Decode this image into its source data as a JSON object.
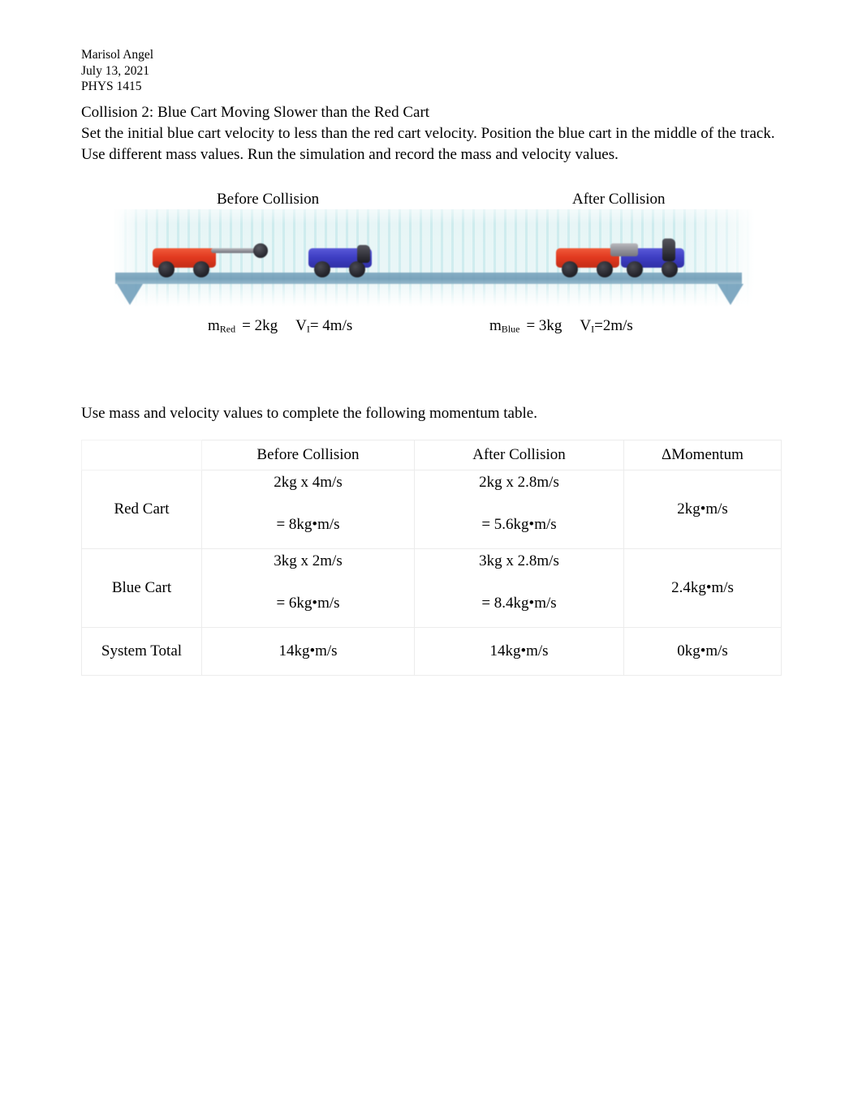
{
  "document": {
    "author": "Marisol Angel",
    "date": "July 13, 2021",
    "course": "PHYS 1415"
  },
  "section": {
    "title": "Collision 2: Blue Cart Moving Slower than the Red Cart",
    "instructions": "Set the initial blue cart velocity to less than the red cart velocity. Position the blue cart in the middle of the track. Use different mass values. Run the simulation and record the mass and velocity values."
  },
  "figure": {
    "before_label": "Before Collision",
    "after_label": "After Collision",
    "red_mass_symbol": "m",
    "red_mass_subscript": "Red",
    "red_mass_value": "= 2kg",
    "red_velocity_symbol": "V",
    "red_velocity_subscript": "I",
    "red_velocity_value": "= 4m/s",
    "blue_mass_symbol": "m",
    "blue_mass_subscript": "Blue",
    "blue_mass_value": "= 3kg",
    "blue_velocity_symbol": "V",
    "blue_velocity_subscript": "I",
    "blue_velocity_value": "=2m/s",
    "colors": {
      "red_cart": "#e23a20",
      "blue_cart": "#3f3fc4",
      "track": "#6f9cb6",
      "background": "#e6f5f6"
    }
  },
  "table_prompt": "Use mass and velocity values to complete the following momentum table.",
  "chart_data": {
    "type": "table",
    "title": "Momentum table",
    "columns": [
      "",
      "Before Collision",
      "After Collision",
      "ΔMomentum"
    ],
    "rows": [
      {
        "label": "Red Cart",
        "before_expr": "2kg x 4m/s",
        "before_result": "= 8kg•m/s",
        "after_expr": "2kg x 2.8m/s",
        "after_result": "= 5.6kg•m/s",
        "delta": "2kg•m/s"
      },
      {
        "label": "Blue Cart",
        "before_expr": "3kg x 2m/s",
        "before_result": "= 6kg•m/s",
        "after_expr": "3kg x 2.8m/s",
        "after_result": "= 8.4kg•m/s",
        "delta": "2.4kg•m/s"
      },
      {
        "label": "System Total",
        "before_expr": "14kg•m/s",
        "before_result": "",
        "after_expr": "14kg•m/s",
        "after_result": "",
        "delta": "0kg•m/s"
      }
    ]
  }
}
